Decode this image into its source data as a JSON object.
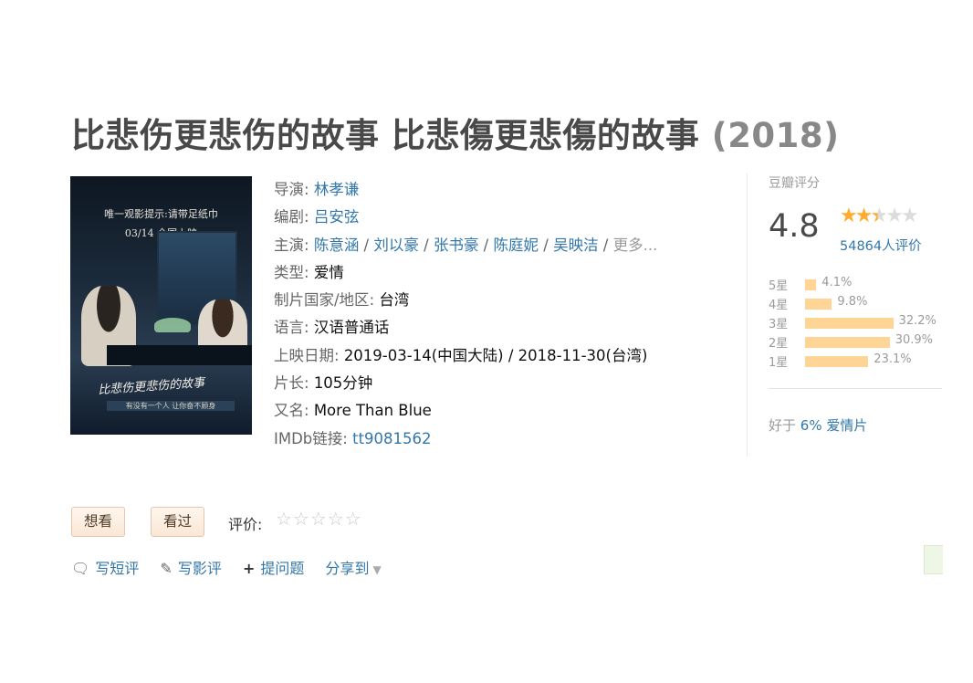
{
  "title": {
    "main": "比悲伤更悲伤的故事 比悲傷更悲傷的故事",
    "year": "(2018)"
  },
  "poster": {
    "tagline": "唯一观影提示:请带足纸巾",
    "release": "03/14 全国上映",
    "title_art": "比悲伤更悲伤的故事",
    "subtitle": "有没有一个人 让你奋不顾身"
  },
  "info": {
    "director_label": "导演",
    "director": "林孝谦",
    "writer_label": "编剧",
    "writer": "吕安弦",
    "cast_label": "主演",
    "cast": [
      "陈意涵",
      "刘以豪",
      "张书豪",
      "陈庭妮",
      "吴映洁"
    ],
    "cast_more": "更多...",
    "genre_label": "类型",
    "genre": "爱情",
    "country_label": "制片国家/地区",
    "country": "台湾",
    "language_label": "语言",
    "language": "汉语普通话",
    "release_label": "上映日期",
    "release": "2019-03-14(中国大陆) / 2018-11-30(台湾)",
    "runtime_label": "片长",
    "runtime": "105分钟",
    "aka_label": "又名",
    "aka": "More Than Blue",
    "imdb_label": "IMDb链接",
    "imdb": "tt9081562"
  },
  "rating": {
    "header": "豆瓣评分",
    "score": "4.8",
    "stars": 2.5,
    "count": "54864人评价",
    "breakdown": [
      {
        "label": "5星",
        "percent": 4.1,
        "text": "4.1%"
      },
      {
        "label": "4星",
        "percent": 9.8,
        "text": "9.8%"
      },
      {
        "label": "3星",
        "percent": 32.2,
        "text": "32.2%"
      },
      {
        "label": "2星",
        "percent": 30.9,
        "text": "30.9%"
      },
      {
        "label": "1星",
        "percent": 23.1,
        "text": "23.1%"
      }
    ],
    "better_than_prefix": "好于",
    "better_than_value": "6%",
    "better_than_genre": "爱情片"
  },
  "actions": {
    "want": "想看",
    "seen": "看过",
    "rate_label": "评价:",
    "rate_stars": "☆☆☆☆☆"
  },
  "links": {
    "short_review": "写短评",
    "review": "写影评",
    "question": "提问题",
    "share": "分享到"
  },
  "colors": {
    "link": "#3377aa",
    "star": "#ffac2d",
    "bar": "#ffd596",
    "button_bg": "#fff6ee"
  },
  "icons": {
    "short_review": "speech-bubble-icon",
    "review": "pencil-icon",
    "question": "plus-icon",
    "share": "caret-down-icon"
  }
}
